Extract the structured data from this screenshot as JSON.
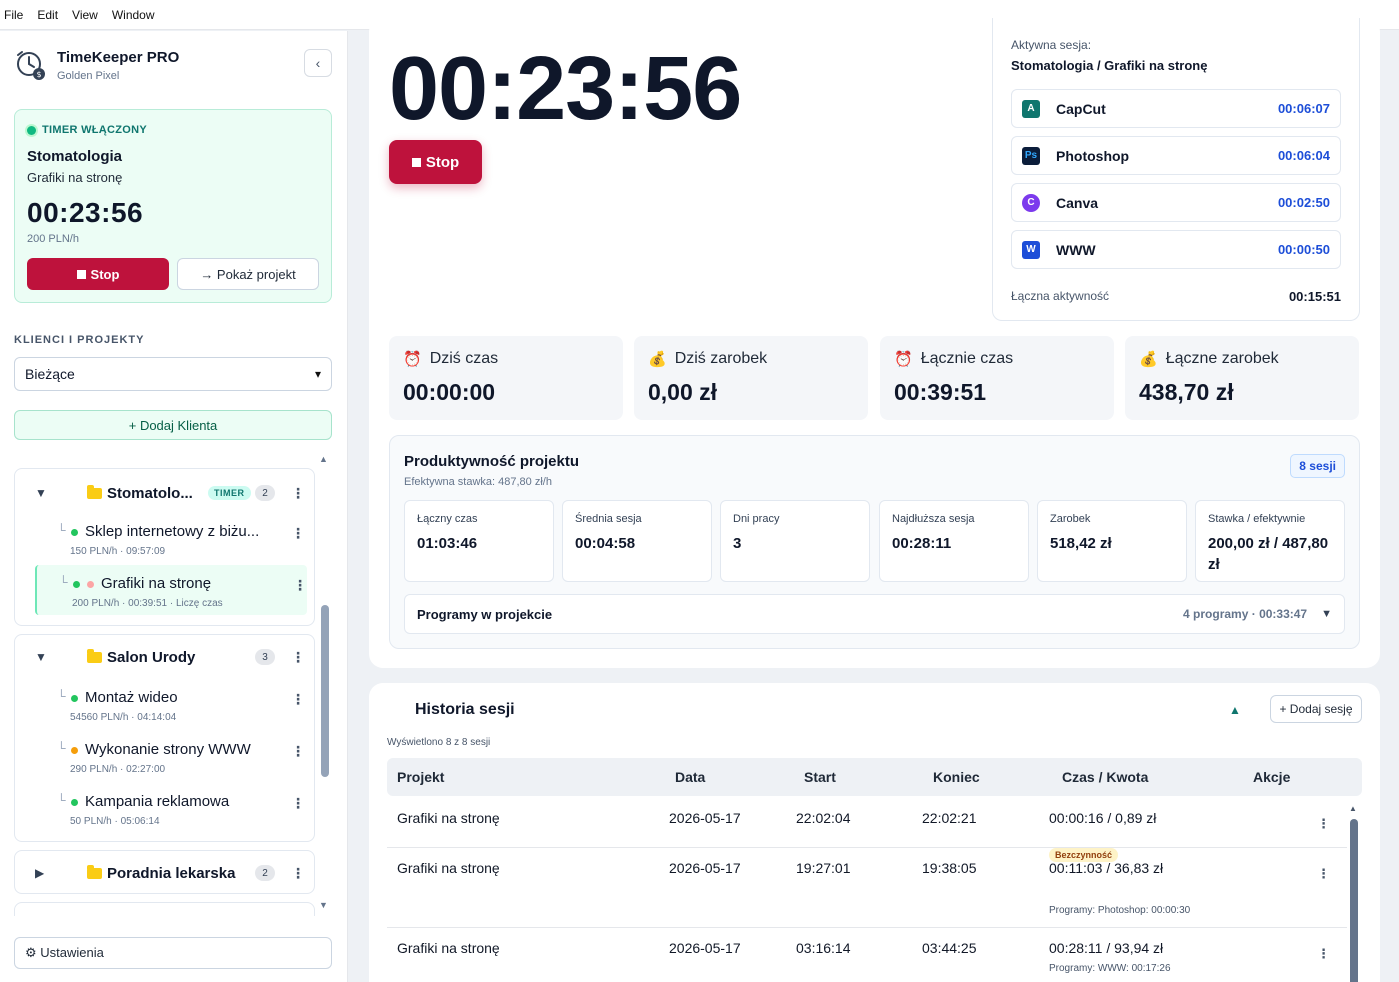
{
  "menu": [
    "File",
    "Edit",
    "View",
    "Window"
  ],
  "brand": {
    "title": "TimeKeeper PRO",
    "subtitle": "Golden Pixel",
    "logo_icon": "clock-money-icon"
  },
  "sidebar": {
    "collapse_icon": "chevron-left-icon",
    "timer_card": {
      "status": "TIMER WŁĄCZONY",
      "client": "Stomatologia",
      "project": "Grafiki na stronę",
      "time": "00:23:56",
      "rate": "200 PLN/h",
      "stop_label": "Stop",
      "show_label": "→ Pokaż projekt"
    },
    "section_label": "KLIENCI I PROJEKTY",
    "filter_value": "Bieżące",
    "add_client_label": "+ Dodaj Klienta",
    "groups": [
      {
        "name": "Stomatolo...",
        "badge": "TIMER",
        "count": "2",
        "expanded": true,
        "projects": [
          {
            "name": "Sklep internetowy z biżu...",
            "meta": "150 PLN/h · 09:57:09",
            "status_color": "#22c55e"
          },
          {
            "name": "Grafiki na stronę",
            "meta": "200 PLN/h · 00:39:51 · Liczę czas",
            "status_color": "#22c55e"
          }
        ]
      },
      {
        "name": "Salon Urody",
        "count": "3",
        "expanded": true,
        "projects": [
          {
            "name": "Montaż wideo",
            "meta": "54560 PLN/h · 04:14:04",
            "status_color": "#22c55e"
          },
          {
            "name": "Wykonanie strony WWW",
            "meta": "290 PLN/h · 02:27:00",
            "status_color": "#f59e0b"
          },
          {
            "name": "Kampania reklamowa",
            "meta": "50 PLN/h · 05:06:14",
            "status_color": "#22c55e"
          }
        ]
      },
      {
        "name": "Poradnia lekarska",
        "count": "2",
        "expanded": false
      }
    ],
    "settings_label": "⚙ Ustawienia"
  },
  "main": {
    "big_time": "00:23:56",
    "stop_label": "Stop",
    "active": {
      "label": "Aktywna sesja:",
      "title": "Stomatologia / Grafiki na stronę",
      "apps": [
        {
          "name": "CapCut",
          "time": "00:06:07",
          "icon": "A",
          "color": "#0f766e"
        },
        {
          "name": "Photoshop",
          "time": "00:06:04",
          "icon": "Ps",
          "color": "#0b1d3a"
        },
        {
          "name": "Canva",
          "time": "00:02:50",
          "icon": "C",
          "color": "#7c3aed"
        },
        {
          "name": "WWW",
          "time": "00:00:50",
          "icon": "W",
          "color": "#1d4ed8"
        }
      ],
      "total_label": "Łączna aktywność",
      "total_value": "00:15:51"
    },
    "stats": [
      {
        "label": "Dziś czas",
        "value": "00:00:00",
        "icon": "⏰"
      },
      {
        "label": "Dziś zarobek",
        "value": "0,00 zł",
        "icon": "💰"
      },
      {
        "label": "Łącznie czas",
        "value": "00:39:51",
        "icon": "⏰"
      },
      {
        "label": "Łączne zarobek",
        "value": "438,70 zł",
        "icon": "💰"
      }
    ],
    "productivity": {
      "title": "Produktywność projektu",
      "subtitle": "Efektywna stawka: 487,80 zł/h",
      "badge": "8 sesji",
      "stats": [
        {
          "label": "Łączny czas",
          "value": "01:03:46"
        },
        {
          "label": "Średnia sesja",
          "value": "00:04:58"
        },
        {
          "label": "Dni pracy",
          "value": "3"
        },
        {
          "label": "Najdłuższa sesja",
          "value": "00:28:11"
        },
        {
          "label": "Zarobek",
          "value": "518,42 zł"
        },
        {
          "label": "Stawka / efektywnie",
          "value": "200,00 zł / 487,80 zł"
        }
      ],
      "programs_label": "Programy w projekcie",
      "programs_summary": "4 programy · 00:33:47"
    },
    "history": {
      "title": "Historia sesji",
      "add_label": "+ Dodaj sesję",
      "count": "Wyświetlono 8 z 8 sesji",
      "columns": [
        "Projekt",
        "Data",
        "Start",
        "Koniec",
        "Czas / Kwota",
        "Akcje"
      ],
      "rows": [
        {
          "project": "Grafiki na stronę",
          "date": "2026-05-17",
          "start": "22:02:04",
          "end": "22:02:21",
          "amount": "00:00:16 / 0,89 zł"
        },
        {
          "project": "Grafiki na stronę",
          "date": "2026-05-17",
          "start": "19:27:01",
          "end": "19:38:05",
          "amount": "00:11:03 / 36,83 zł",
          "badge": "Bezczynność",
          "programs": "Programy: Photoshop: 00:00:30"
        },
        {
          "project": "Grafiki na stronę",
          "date": "2026-05-17",
          "start": "03:16:14",
          "end": "03:44:25",
          "amount": "00:28:11 / 93,94 zł",
          "programs": "Programy: WWW: 00:17:26"
        }
      ]
    }
  }
}
